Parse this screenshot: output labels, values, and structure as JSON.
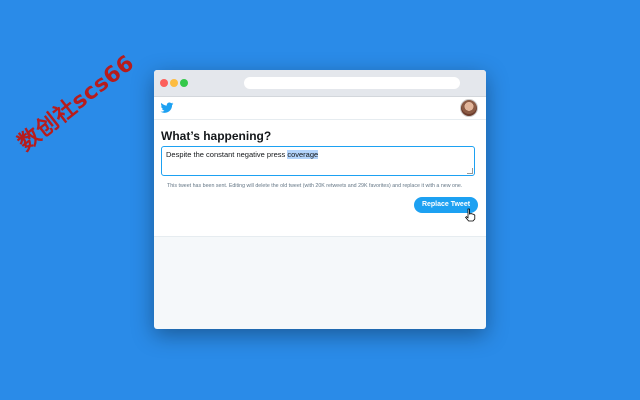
{
  "watermark": {
    "text": "数创社scs66"
  },
  "twitter": {
    "heading": "What’s happening?",
    "tweet_text_before": "Despite the constant negative press ",
    "tweet_text_selected": "coverage",
    "notice": "This tweet has been sent. Editing will delete the old tweet (with 20K retweets and 29K favorites) and replace it with a new one.",
    "replace_label": "Replace Tweet"
  },
  "icons": {
    "bird": "twitter-bird-icon",
    "cursor": "hand-pointer-icon"
  },
  "colors": {
    "background": "#2a8be8",
    "accent": "#1da1f2",
    "selection": "#b3d4fc"
  }
}
